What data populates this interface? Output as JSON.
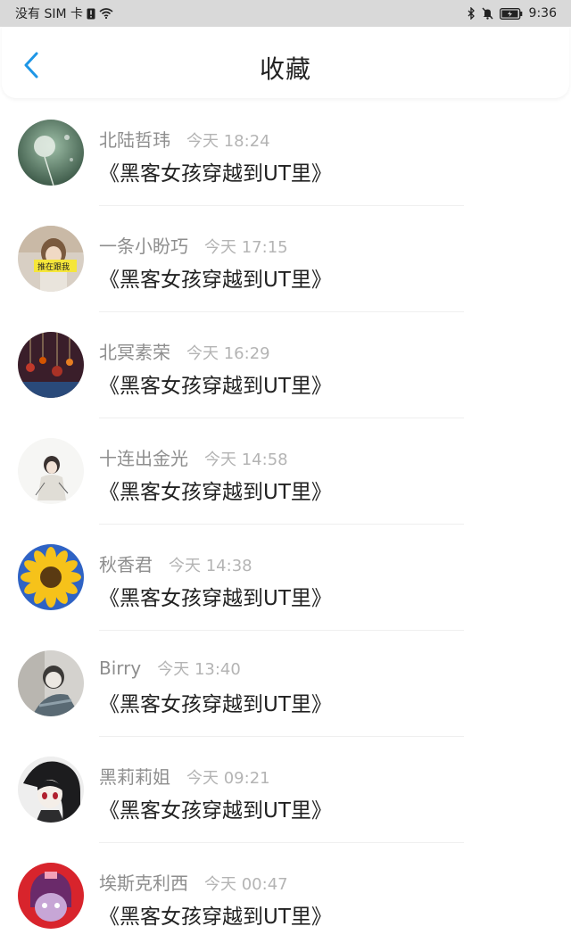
{
  "status_bar": {
    "carrier": "没有 SIM 卡",
    "time": "9:36",
    "icons": [
      "sim-alert-icon",
      "wifi-icon",
      "bluetooth-icon",
      "mute-bell-icon",
      "battery-charging-icon"
    ]
  },
  "header": {
    "title": "收藏",
    "back_icon": "chevron-left-icon"
  },
  "colors": {
    "accent": "#1e96e6",
    "author": "#8e8e8e",
    "time": "#b4b4b4",
    "book": "#222222"
  },
  "favorites": [
    {
      "author": "北陆哲玮",
      "time": "今天 18:24",
      "book": "《黑客女孩穿越到UT里》",
      "avatar": "dandelion-avatar"
    },
    {
      "author": "一条小盼巧",
      "time": "今天 17:15",
      "book": "《黑客女孩穿越到UT里》",
      "avatar": "girl-photo-avatar"
    },
    {
      "author": "北冥素荣",
      "time": "今天 16:29",
      "book": "《黑客女孩穿越到UT里》",
      "avatar": "ornaments-avatar"
    },
    {
      "author": "十连出金光",
      "time": "今天 14:58",
      "book": "《黑客女孩穿越到UT里》",
      "avatar": "anime-sketch-avatar"
    },
    {
      "author": "秋香君",
      "time": "今天 14:38",
      "book": "《黑客女孩穿越到UT里》",
      "avatar": "sunflower-avatar"
    },
    {
      "author": "Birry",
      "time": "今天 13:40",
      "book": "《黑客女孩穿越到UT里》",
      "avatar": "masked-person-avatar"
    },
    {
      "author": "黑莉莉姐",
      "time": "今天 09:21",
      "book": "《黑客女孩穿越到UT里》",
      "avatar": "anime-dark-avatar"
    },
    {
      "author": "埃斯克利西",
      "time": "今天 00:47",
      "book": "《黑客女孩穿越到UT里》",
      "avatar": "red-character-avatar"
    }
  ]
}
